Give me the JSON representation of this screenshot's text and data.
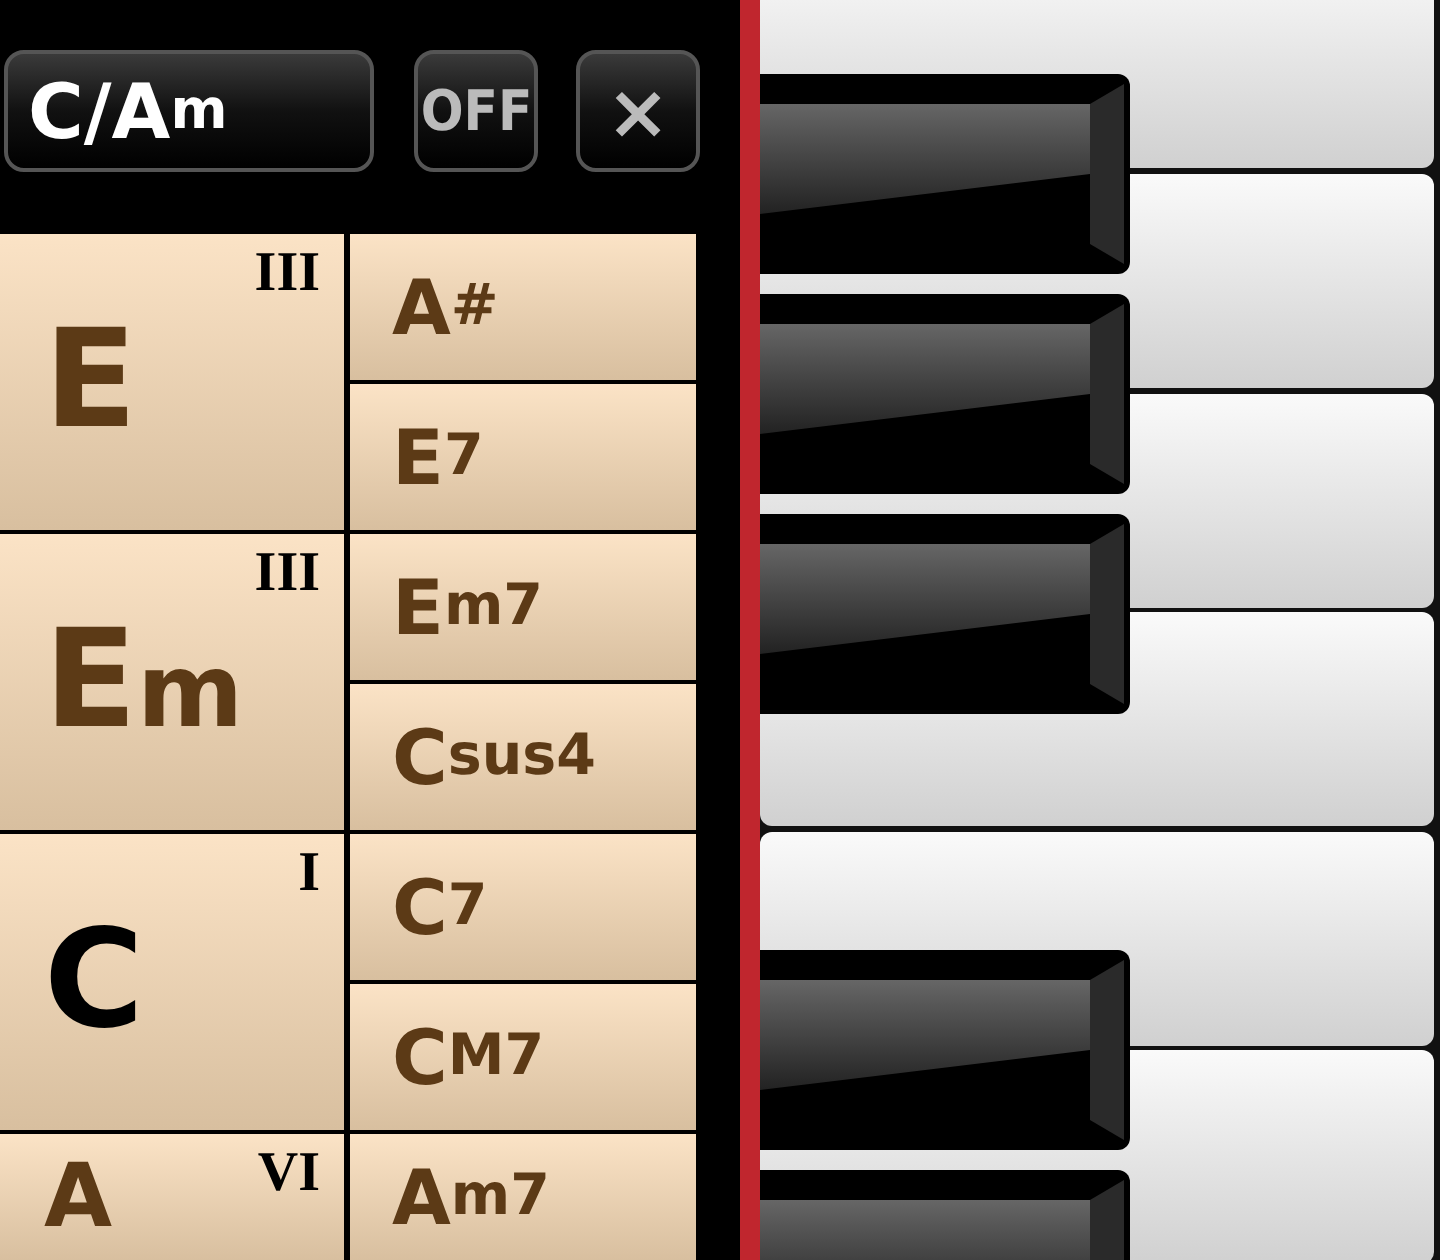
{
  "toolbar": {
    "key": {
      "root": "C/A",
      "suffix": "m"
    },
    "toggle": "OFF",
    "close": "×"
  },
  "chord_rows": [
    {
      "degree": "III",
      "chord": {
        "root": "E"
      },
      "selected": false,
      "variants": [
        {
          "root": "A",
          "suffix": "#"
        },
        {
          "root": "E",
          "suffix": "7"
        }
      ]
    },
    {
      "degree": "III",
      "chord": {
        "root": "E",
        "suffix": "m"
      },
      "selected": false,
      "variants": [
        {
          "root": "E",
          "suffix": "m7"
        },
        {
          "root": "C",
          "suffix": "sus4"
        }
      ]
    },
    {
      "degree": "I",
      "chord": {
        "root": "C"
      },
      "selected": true,
      "variants": [
        {
          "root": "C",
          "suffix": "7"
        },
        {
          "root": "C",
          "suffix": "M7"
        }
      ]
    },
    {
      "degree": "VI",
      "chord": {
        "root": "A"
      },
      "selected": false,
      "variants": [
        {
          "root": "A",
          "suffix": "m7"
        }
      ]
    }
  ]
}
